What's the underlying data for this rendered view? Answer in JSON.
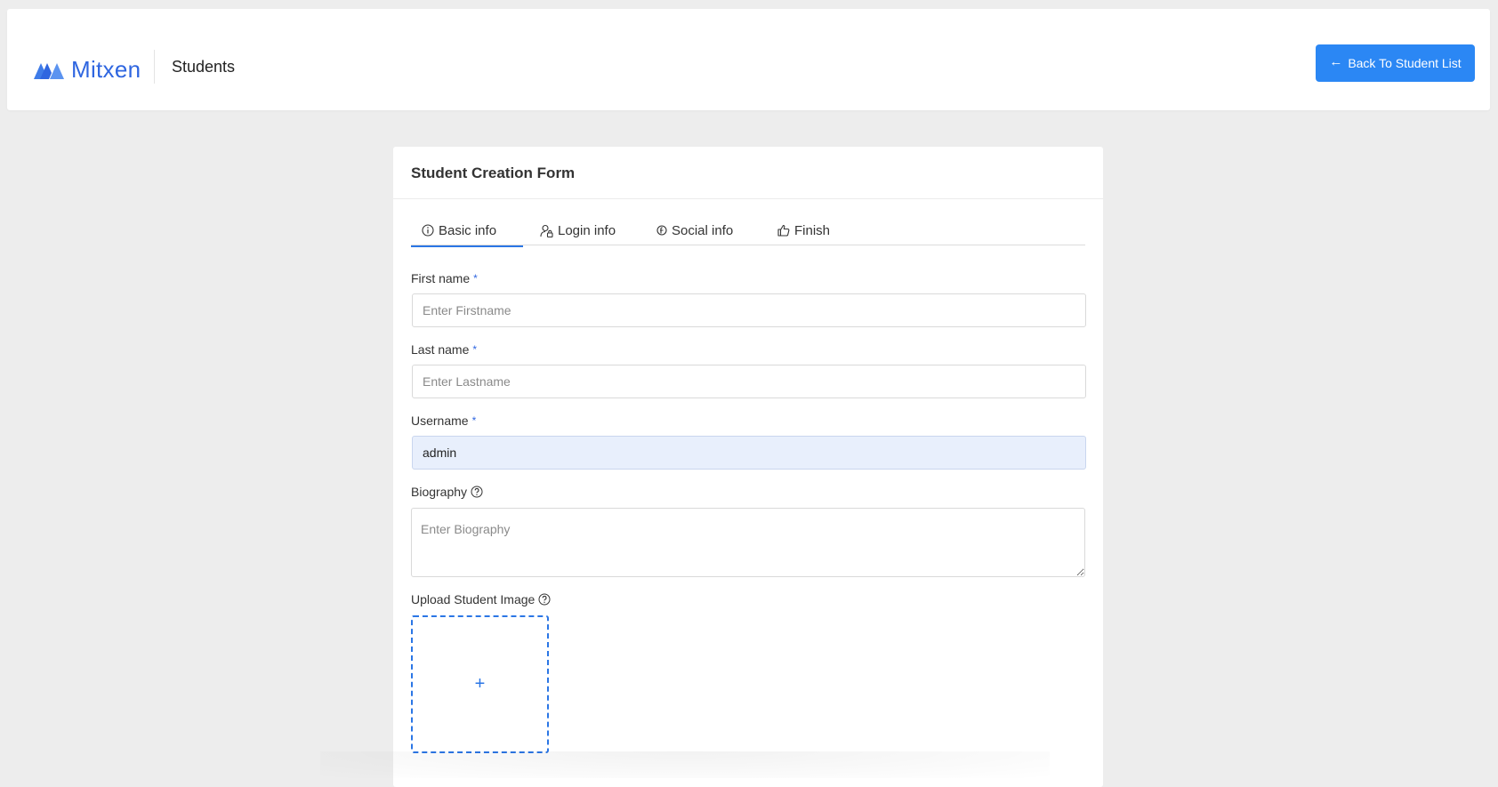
{
  "header": {
    "logo_text": "Mitxen",
    "page_title": "Students",
    "back_button_label": "Back To Student List",
    "back_button_icon": "arrow-left-icon"
  },
  "form": {
    "title": "Student Creation Form",
    "tabs": [
      {
        "label": "Basic info",
        "icon": "info-circle-icon",
        "active": true
      },
      {
        "label": "Login info",
        "icon": "user-lock-icon",
        "active": false
      },
      {
        "label": "Social info",
        "icon": "social-icon",
        "active": false
      },
      {
        "label": "Finish",
        "icon": "thumbs-up-icon",
        "active": false
      }
    ],
    "first_name": {
      "label": "First name",
      "required_mark": "*",
      "placeholder": "Enter Firstname",
      "value": ""
    },
    "last_name": {
      "label": "Last name",
      "required_mark": "*",
      "placeholder": "Enter Lastname",
      "value": ""
    },
    "username": {
      "label": "Username",
      "required_mark": "*",
      "placeholder": "",
      "value": "admin"
    },
    "biography": {
      "label": "Biography",
      "placeholder": "Enter Biography"
    },
    "upload": {
      "label": "Upload Student Image",
      "plus": "+"
    }
  },
  "colors": {
    "accent": "#2b87f4",
    "brand": "#2f66e0",
    "autofill_bg": "#e8effc"
  }
}
